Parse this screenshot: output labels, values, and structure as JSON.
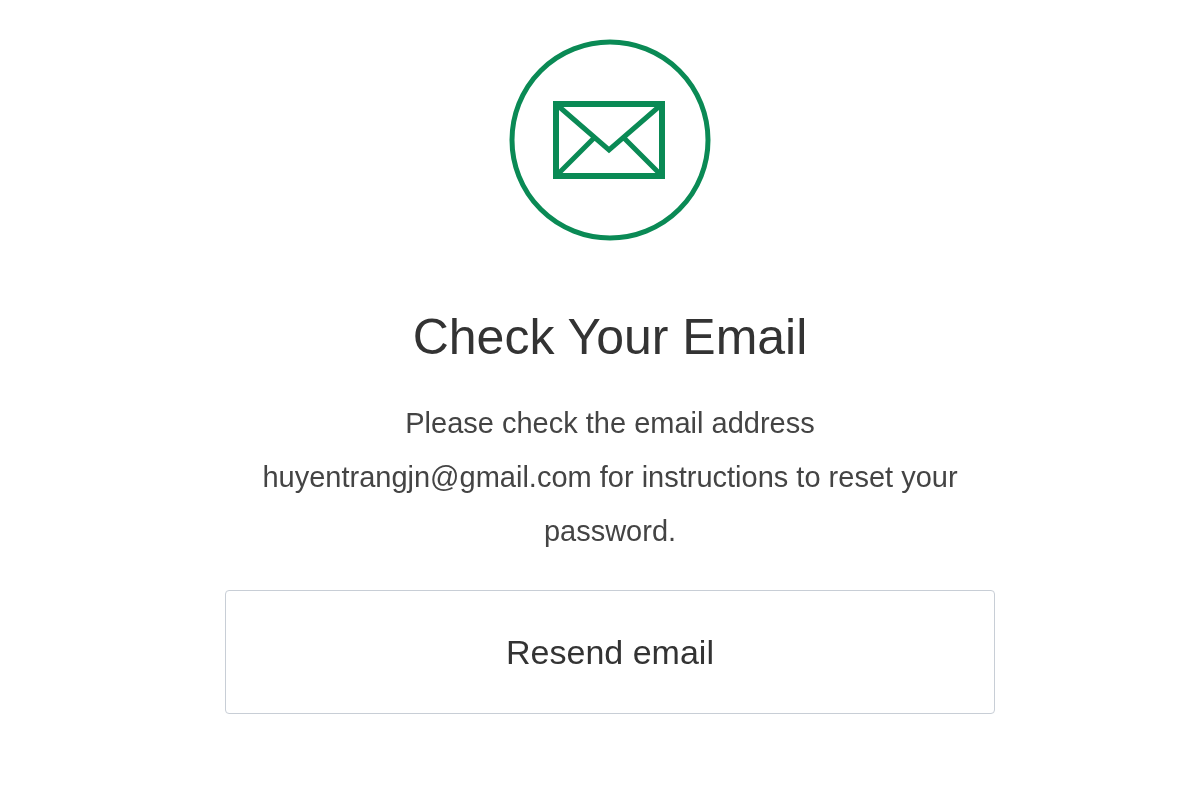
{
  "title": "Check Your Email",
  "message": "Please check the email address huyentrangjn@gmail.com for instructions to reset your password.",
  "button": "Resend email"
}
